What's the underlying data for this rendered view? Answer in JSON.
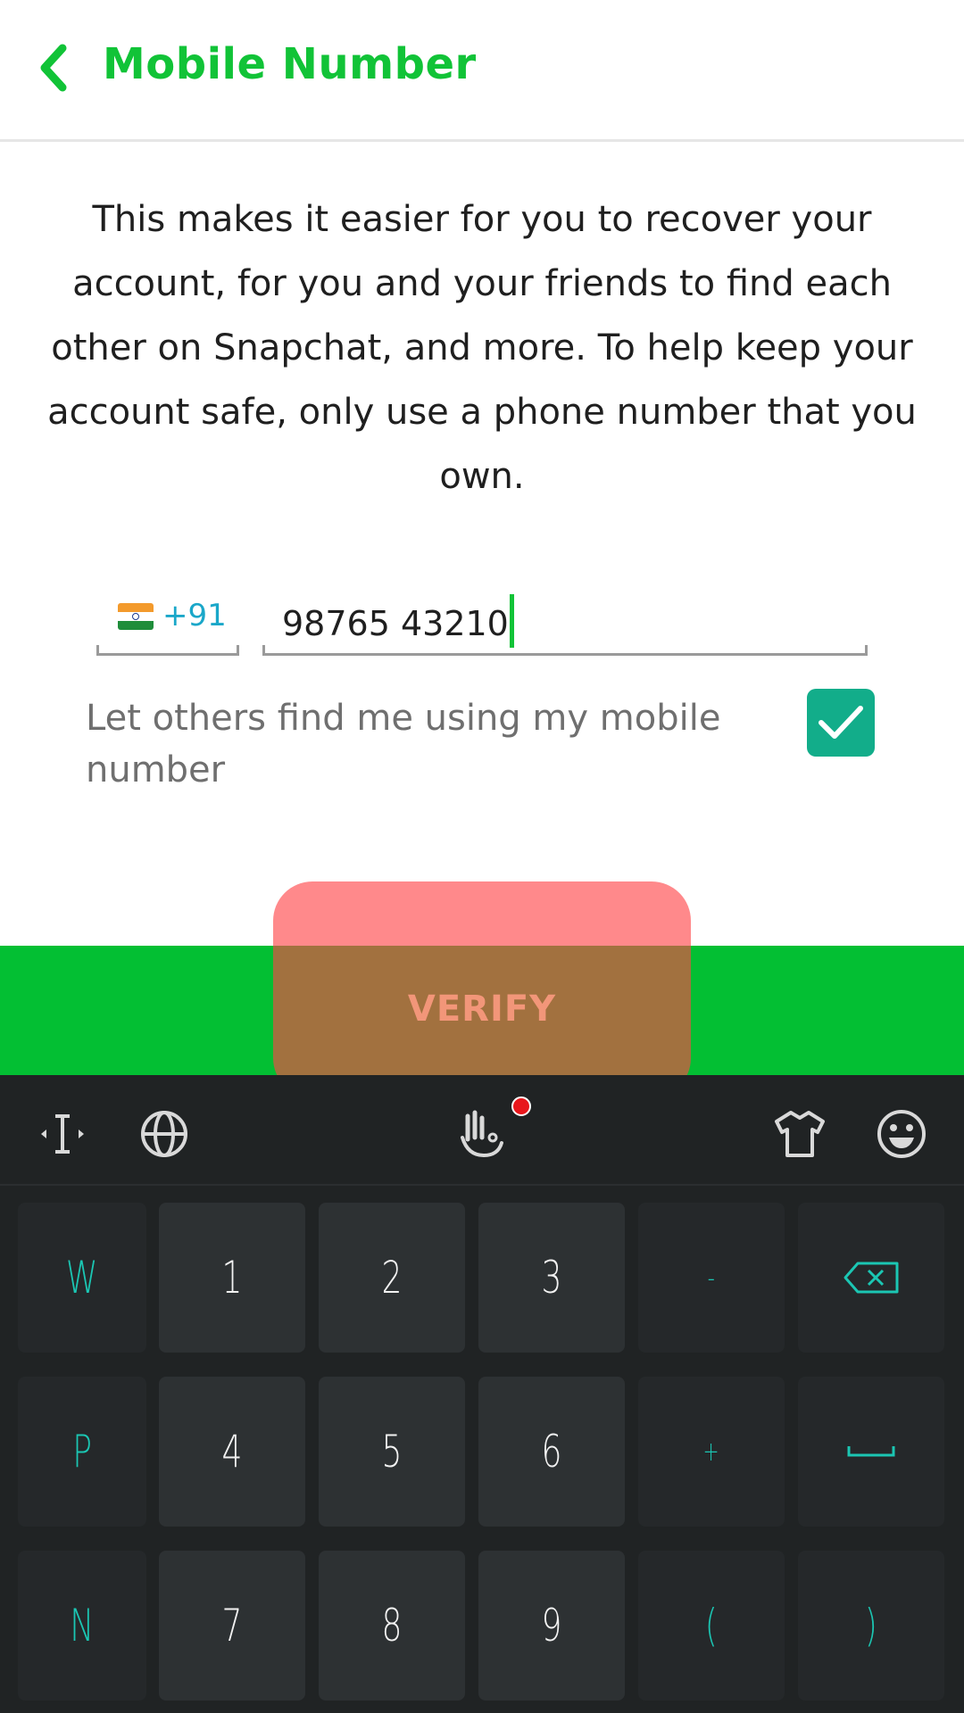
{
  "header": {
    "title": "Mobile Number",
    "back_icon": "chevron-left-icon"
  },
  "description": "This makes it easier for you to recover your account, for you and your friends to find each other on Snapchat, and more. To help keep your account safe, only use a phone number that you own.",
  "phone": {
    "country_flag": "india-flag-icon",
    "country_code": "+91",
    "value": "98765 43210"
  },
  "discoverable": {
    "label": "Let others find me using my mobile number",
    "checked": true
  },
  "verify": {
    "label": "VERIFY"
  },
  "keyboard": {
    "toolbar_icons": [
      "text-cursor-icon",
      "globe-icon",
      "gesture-hand-icon",
      "shirt-theme-icon",
      "emoji-icon"
    ],
    "rows": [
      [
        "W",
        "1",
        "2",
        "3",
        "-",
        "backspace-icon"
      ],
      [
        "P",
        "4",
        "5",
        "6",
        "+",
        "space-icon"
      ],
      [
        "N",
        "7",
        "8",
        "9",
        "(",
        ")"
      ]
    ]
  },
  "colors": {
    "brand_green": "#11c337",
    "bar_green": "#03bf33",
    "checkbox_teal": "#12ad8a",
    "keyboard_accent": "#1bc6b3",
    "keyboard_bg": "#202324"
  }
}
